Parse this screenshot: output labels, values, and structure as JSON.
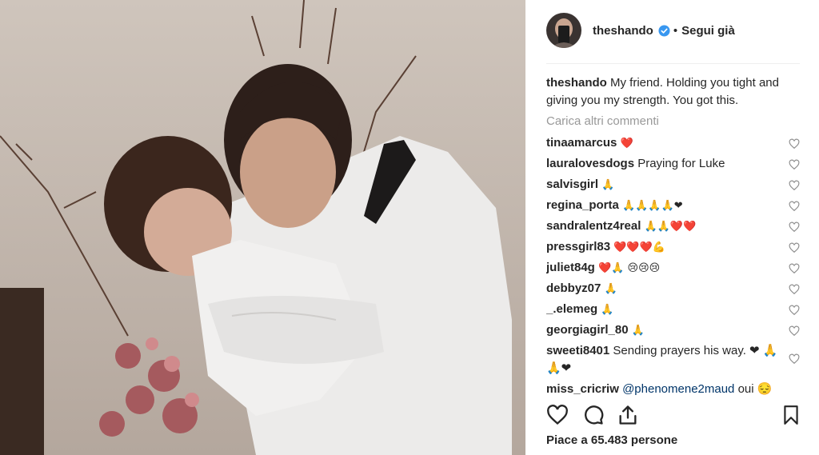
{
  "post": {
    "username": "theshando",
    "follow_label": "Segui già",
    "separator": "•",
    "caption_text": "My friend. Holding you tight and giving you my strength. You got this.",
    "load_more_label": "Carica altri commenti",
    "likes_label": "Piace a 65.483 persone"
  },
  "comments": [
    {
      "user": "tinaamarcus",
      "text": "❤️"
    },
    {
      "user": "lauralovesdogs",
      "text": "Praying for Luke"
    },
    {
      "user": "salvisgirl",
      "text": "🙏"
    },
    {
      "user": "regina_porta",
      "text": "🙏🙏🙏🙏❤"
    },
    {
      "user": "sandralentz4real",
      "text": "🙏🙏❤️❤️"
    },
    {
      "user": "pressgirl83",
      "text": "❤️❤️❤️💪"
    },
    {
      "user": "juliet84g",
      "text": "❤️🙏 😢😢😢"
    },
    {
      "user": "debbyz07",
      "text": "🙏"
    },
    {
      "user": "_.elemeg",
      "text": "🙏"
    },
    {
      "user": "georgiagirl_80",
      "text": "🙏"
    },
    {
      "user": "sweeti8401",
      "text": "Sending prayers his way. ❤ 🙏🙏❤"
    },
    {
      "user": "miss_cricriw",
      "mention": "@phenomene2maud",
      "text": "oui 😔"
    }
  ],
  "colors": {
    "verified": "#3897f0",
    "text": "#262626",
    "muted": "#999999",
    "heart": "#ed4956"
  },
  "icons": {
    "like": "heart-outline-icon",
    "comment": "speech-bubble-icon",
    "share": "share-icon",
    "save": "bookmark-icon"
  }
}
